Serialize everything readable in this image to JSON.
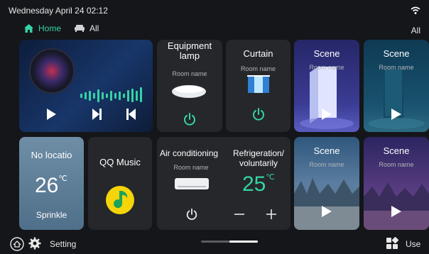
{
  "status": {
    "datetime": "Wednesday April 24  02:12",
    "wifi_icon": "wifi-icon"
  },
  "nav": {
    "tabs": [
      {
        "label": "Home",
        "icon": "home-icon",
        "color": "#35d3a6"
      },
      {
        "label": "All",
        "icon": "sofa-icon"
      }
    ],
    "all_label": "All"
  },
  "cards": {
    "music": {
      "controls": [
        "play-icon",
        "next-icon",
        "previous-icon"
      ],
      "accent": "#35d3a6"
    },
    "lamp": {
      "title": "Equipment lamp",
      "room": "Room name",
      "accent": "#35d3a6"
    },
    "curtain": {
      "title": "Curtain",
      "room": "Room name"
    },
    "scenes": [
      {
        "title": "Scene",
        "room": "Room name"
      },
      {
        "title": "Scene",
        "room": "Room name"
      },
      {
        "title": "Scene",
        "room": "Room name"
      },
      {
        "title": "Scene",
        "room": "Room name"
      }
    ],
    "weather": {
      "location": "No locatio",
      "temp": "26",
      "unit": "℃",
      "condition": "Sprinkle"
    },
    "qq": {
      "title": "QQ Music",
      "brand_color": "#f5d40a"
    },
    "aircon": {
      "title": "Air conditioning",
      "room": "Room name"
    },
    "refrigeration": {
      "title": "Refrigeration/ voluntarily",
      "temp": "25",
      "unit": "℃",
      "accent": "#35d3a6"
    }
  },
  "bottom": {
    "setting_label": "Setting",
    "use_label": "Use"
  }
}
